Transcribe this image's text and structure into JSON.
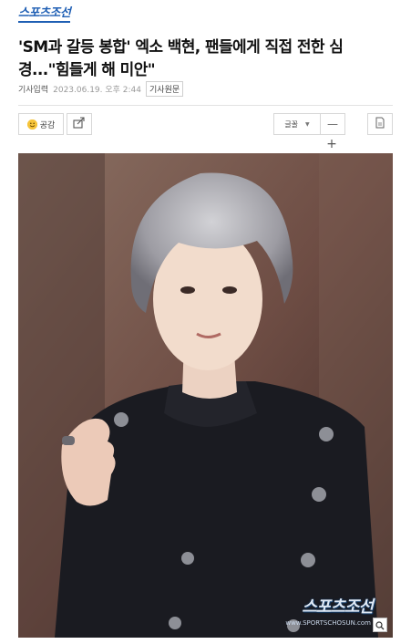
{
  "header": {
    "logo": "스포츠조선"
  },
  "article": {
    "title": "'SM과 갈등 봉합' 엑소 백현, 팬들에게 직접 전한 심경...\"힘들게 해 미안\"",
    "meta_label": "기사입력",
    "date": "2023.06.19. 오후 2:44",
    "original_link": "기사원문"
  },
  "toolbar": {
    "like_label": "공감",
    "share_icon": "share-icon",
    "font_label": "글꼴",
    "minus_label": "—",
    "plus_label": "+",
    "print_icon": "print-icon"
  },
  "photo": {
    "watermark": "스포츠조선",
    "watermark_url": "www.SPORTSCHOSUN.com",
    "zoom_icon": "magnifier-icon"
  },
  "colors": {
    "brand": "#1f5fb4",
    "watermark": "#dfe9f5"
  }
}
